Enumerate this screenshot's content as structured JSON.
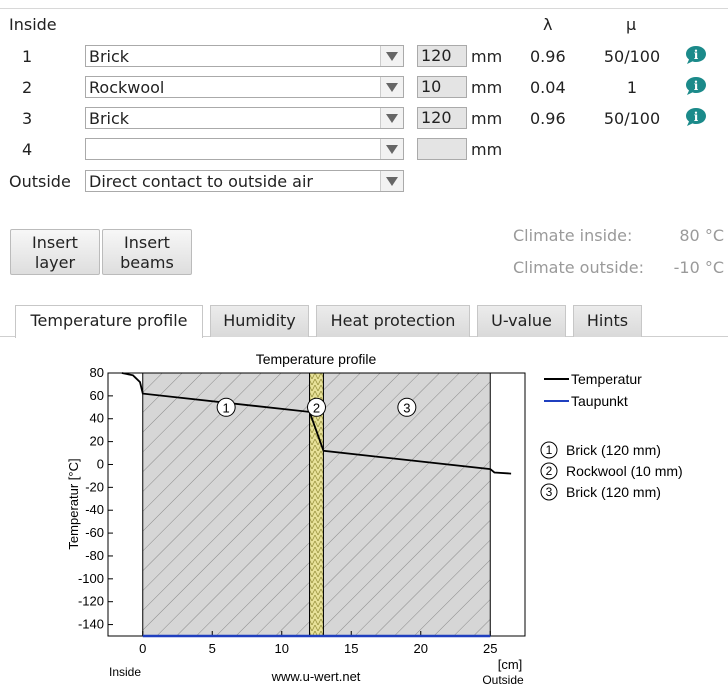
{
  "header": {
    "inside_label": "Inside",
    "lambda_label": "λ",
    "mu_label": "μ"
  },
  "layers": [
    {
      "num": "1",
      "material": "Brick",
      "thickness": "120",
      "unit": "mm",
      "lambda": "0.96",
      "mu": "50/100"
    },
    {
      "num": "2",
      "material": "Rockwool",
      "thickness": "10",
      "unit": "mm",
      "lambda": "0.04",
      "mu": "1"
    },
    {
      "num": "3",
      "material": "Brick",
      "thickness": "120",
      "unit": "mm",
      "lambda": "0.96",
      "mu": "50/100"
    },
    {
      "num": "4",
      "material": "",
      "thickness": "",
      "unit": "mm"
    }
  ],
  "outside": {
    "label": "Outside",
    "value": "Direct contact to outside air"
  },
  "buttons": {
    "insert_layer": [
      "Insert",
      "layer"
    ],
    "insert_beams": [
      "Insert",
      "beams"
    ]
  },
  "climate": {
    "inside_label": "Climate inside:",
    "inside_value": "80 °C",
    "outside_label": "Climate outside:",
    "outside_value": "-10 °C"
  },
  "tabs": [
    "Temperature profile",
    "Humidity",
    "Heat protection",
    "U-value",
    "Hints"
  ],
  "active_tab": 0,
  "icons": {
    "info": "info-speech-icon",
    "select_arrow": "chevron-down-icon"
  },
  "colors": {
    "info_icon": "#1b8a8a",
    "insulation": "#e8e29a",
    "temperature_line": "#000000",
    "dewpoint_line": "#1f3fbf"
  },
  "chart_data": {
    "type": "line",
    "title": "Temperature profile",
    "ylabel": "Temperatur [°C]",
    "xlabel": "[cm]",
    "xlim": [
      -2.5,
      27.5
    ],
    "ylim": [
      -150,
      80
    ],
    "xticks": [
      0,
      5,
      10,
      15,
      20,
      25
    ],
    "yticks": [
      80,
      60,
      40,
      20,
      0,
      -20,
      -40,
      -60,
      -80,
      -100,
      -120,
      -140
    ],
    "x_start_label": "Inside",
    "x_end_label": "Outside",
    "watermark": "www.u-wert.net",
    "layers": [
      {
        "marker": "1",
        "name": "Brick (120 mm)",
        "x_from": 0,
        "x_to": 12
      },
      {
        "marker": "2",
        "name": "Rockwool (10 mm)",
        "x_from": 12,
        "x_to": 13
      },
      {
        "marker": "3",
        "name": "Brick (120 mm)",
        "x_from": 13,
        "x_to": 25
      }
    ],
    "series": [
      {
        "name": "Temperatur",
        "x": [
          -1.5,
          -0.7,
          -0.2,
          0,
          12,
          13,
          25,
          25.3,
          26.5
        ],
        "y": [
          80,
          78,
          72,
          62,
          46,
          12,
          -4,
          -7,
          -8
        ]
      },
      {
        "name": "Taupunkt",
        "x": [
          0,
          25
        ],
        "y": [
          -150,
          -150
        ]
      }
    ],
    "legend": "right"
  }
}
